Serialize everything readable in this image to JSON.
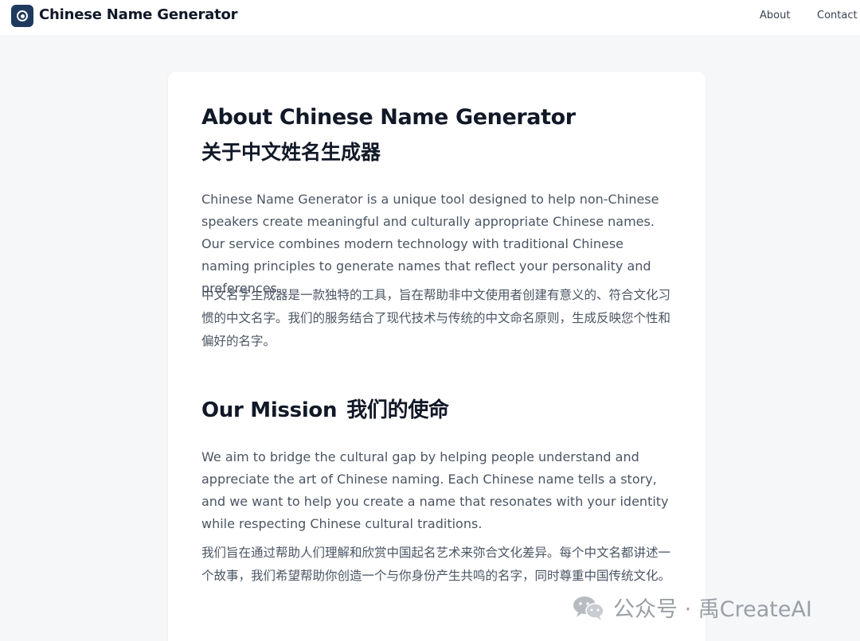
{
  "header": {
    "app_title": "Chinese Name Generator",
    "nav": [
      {
        "label": "About"
      },
      {
        "label": "Contact"
      }
    ]
  },
  "about": {
    "title_en": "About Chinese Name Generator",
    "title_zh": "关于中文姓名生成器",
    "body_en": "Chinese Name Generator is a unique tool designed to help non-Chinese speakers create meaningful and culturally appropriate Chinese names. Our service combines modern technology with traditional Chinese naming principles to generate names that reflect your personality and preferences.",
    "body_zh": "中文名字生成器是一款独特的工具，旨在帮助非中文使用者创建有意义的、符合文化习惯的中文名字。我们的服务结合了现代技术与传统的中文命名原则，生成反映您个性和偏好的名字。"
  },
  "mission": {
    "title_en": "Our Mission",
    "title_zh": "我们的使命",
    "body_en": "We aim to bridge the cultural gap by helping people understand and appreciate the art of Chinese naming. Each Chinese name tells a story, and we want to help you create a name that resonates with your identity while respecting Chinese cultural traditions.",
    "body_zh": "我们旨在通过帮助人们理解和欣赏中国起名艺术来弥合文化差异。每个中文名都讲述一个故事，我们希望帮助你创造一个与你身份产生共鸣的名字，同时尊重中国传统文化。"
  },
  "watermark": {
    "text": "公众号 · 禹CreateAI",
    "icon": "wechat-icon"
  },
  "colors": {
    "brand": "#1e3a5f",
    "background": "#f6f7f9",
    "heading": "#111827",
    "body": "#4b5563"
  }
}
